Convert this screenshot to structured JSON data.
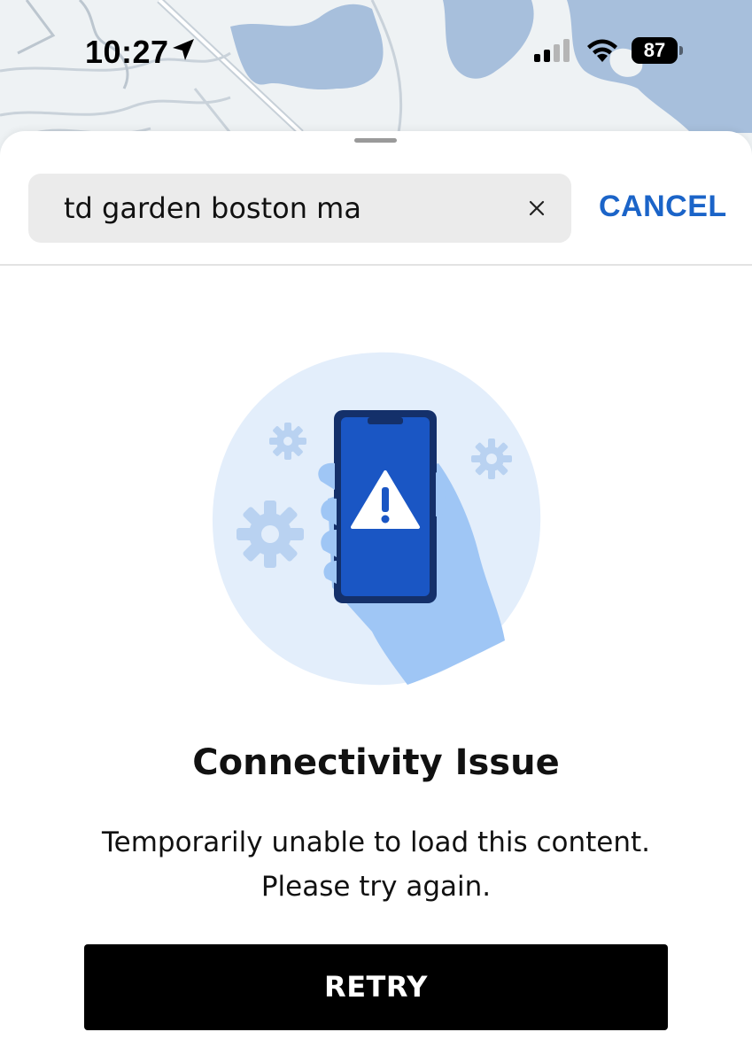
{
  "status_bar": {
    "time": "10:27",
    "battery_level": "87"
  },
  "search": {
    "value": "td garden boston ma",
    "cancel_label": "CANCEL"
  },
  "error": {
    "title": "Connectivity Issue",
    "message_line1": "Temporarily unable to load this content.",
    "message_line2": "Please try again."
  },
  "actions": {
    "retry_label": "RETRY"
  },
  "colors": {
    "accent": "#1b64c8",
    "map_water": "#a7bfdc",
    "map_land": "#eef2f4",
    "illustration_circle": "#e3eefb",
    "phone_blue": "#1a56c4",
    "hand_blue": "#9fc6f5"
  },
  "icons": {
    "location": "location-arrow-icon",
    "signal": "cellular-signal-icon",
    "wifi": "wifi-icon",
    "clear": "close-icon",
    "illustration": "phone-warning-illustration"
  }
}
